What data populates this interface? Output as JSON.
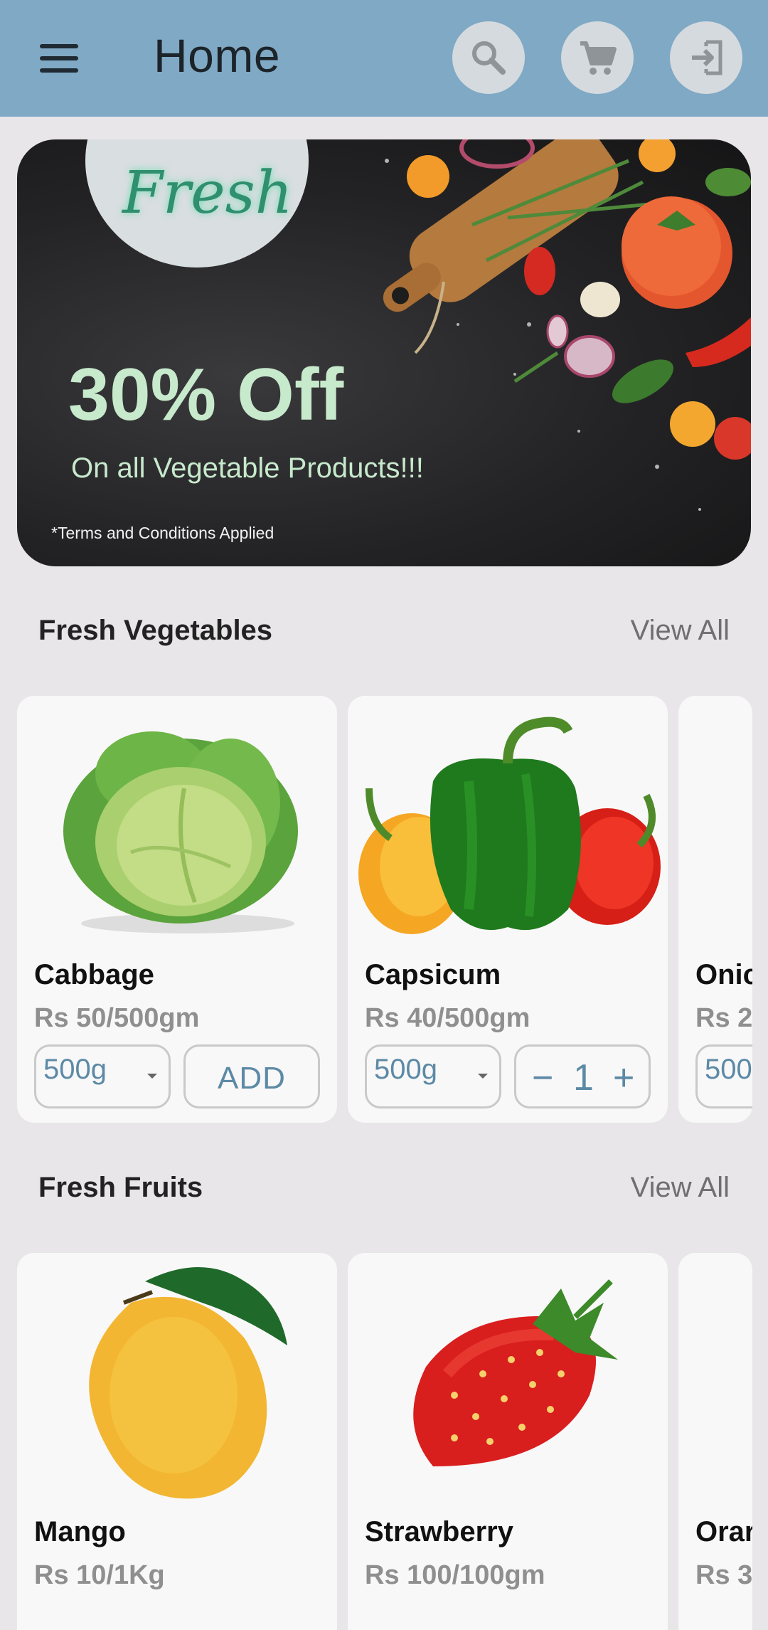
{
  "appbar": {
    "title": "Home",
    "icons": [
      "menu-icon",
      "search-icon",
      "cart-icon",
      "logout-icon"
    ]
  },
  "banner": {
    "badge_text": "Fresh",
    "offer": "30% Off",
    "offer_sub": "On all Vegetable Products!!!",
    "terms": "*Terms and Conditions Applied"
  },
  "sections": {
    "vegetables": {
      "title": "Fresh Vegetables",
      "view_all": "View All",
      "items": [
        {
          "name": "Cabbage",
          "price": "Rs 50/500gm",
          "unit": "500g",
          "action": "ADD"
        },
        {
          "name": "Capsicum",
          "price": "Rs 40/500gm",
          "unit": "500g",
          "qty": "1",
          "minus": "−",
          "plus": "+"
        },
        {
          "name": "Onic",
          "price": "Rs 2",
          "unit": "500"
        }
      ]
    },
    "fruits": {
      "title": "Fresh Fruits",
      "view_all": "View All",
      "items": [
        {
          "name": "Mango",
          "price": "Rs 10/1Kg"
        },
        {
          "name": "Strawberry",
          "price": "Rs 100/100gm"
        },
        {
          "name": "Orar",
          "price": "Rs 3"
        }
      ]
    }
  },
  "colors": {
    "appbar": "#7FA9C4",
    "accent": "#5C8AA6",
    "offer_text": "#C7E9CC",
    "badge_text": "#2F8F6F"
  }
}
